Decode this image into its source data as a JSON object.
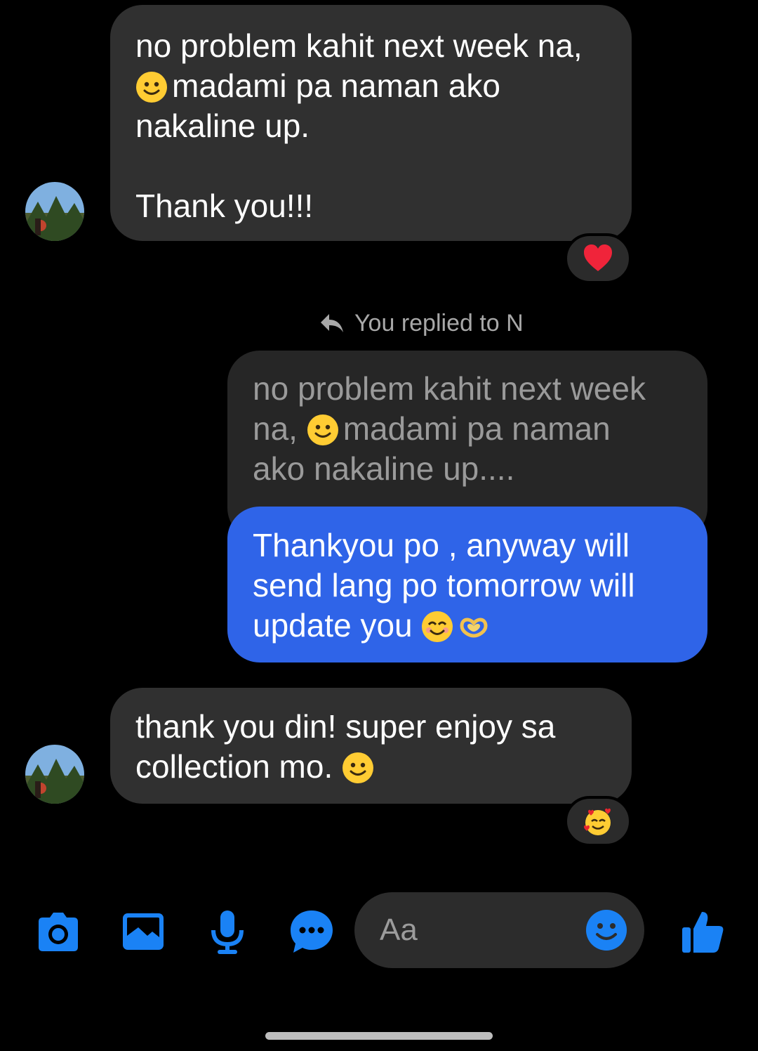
{
  "colors": {
    "background": "#000000",
    "incoming_bubble": "#303030",
    "outgoing_bubble": "#2f64e8",
    "accent_icon": "#1a82f5"
  },
  "messages": {
    "first": {
      "lines": [
        "no problem kahit next week na,",
        "madami pa naman ako",
        "nakaline up.",
        "Thank you!!!"
      ],
      "reaction": "heart-reaction"
    },
    "reply_header": "You replied to N",
    "quoted": {
      "lines": [
        "no problem kahit next week",
        "na,",
        "madami pa naman",
        "ako nakaline up...."
      ]
    },
    "mine": {
      "lines": [
        "Thankyou po , anyway will",
        "send lang po tomorrow will",
        "update you"
      ]
    },
    "last": {
      "lines": [
        "thank you din! super enjoy sa",
        "collection mo."
      ],
      "reaction": "smiling-face-with-hearts-reaction"
    }
  },
  "composer": {
    "placeholder": "Aa",
    "icons": [
      "camera-icon",
      "gallery-icon",
      "microphone-icon",
      "more-chat-icon",
      "emoji-icon",
      "thumbs-up-icon"
    ]
  }
}
